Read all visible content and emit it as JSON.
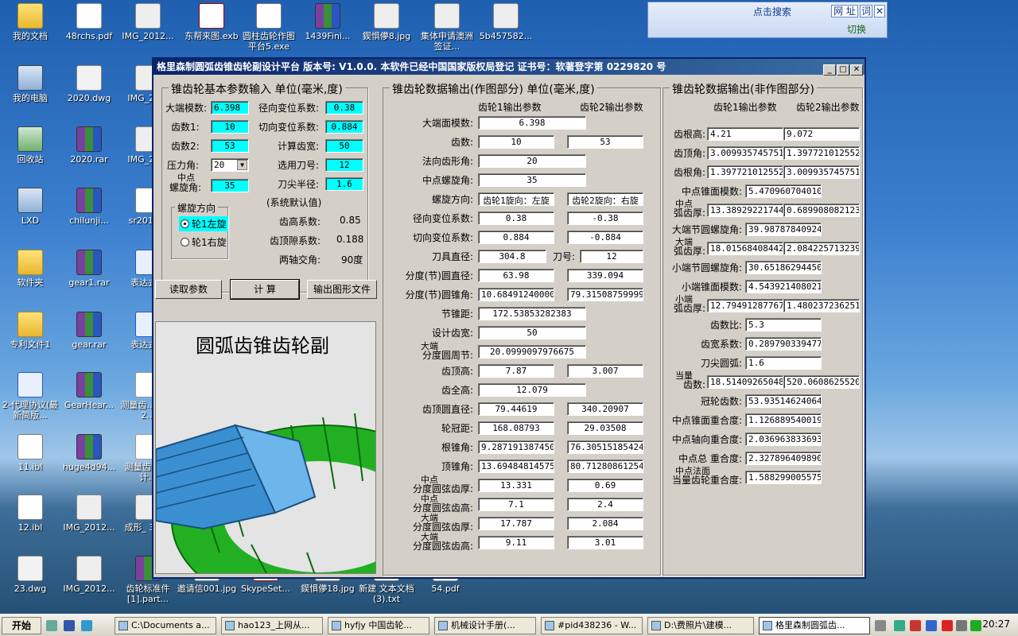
{
  "desktop": {
    "icons": [
      {
        "label": "我的文档",
        "kind": "folder"
      },
      {
        "label": "48rchs.pdf",
        "kind": "pdf"
      },
      {
        "label": "IMG_2012...",
        "kind": "jpg"
      },
      {
        "label": "东帮来图.exb",
        "kind": "exe"
      },
      {
        "label": "圆柱齿轮作图平台5.exe",
        "kind": "file"
      },
      {
        "label": "1439Fini...",
        "kind": "rar"
      },
      {
        "label": "鍥惧儚8.jpg",
        "kind": "jpg"
      },
      {
        "label": "集体申请澳洲签证...",
        "kind": "jpg"
      },
      {
        "label": "5b457582...",
        "kind": "jpg"
      },
      {
        "label": "我的电脑",
        "kind": "pc"
      },
      {
        "label": "2020.dwg",
        "kind": "dwg"
      },
      {
        "label": "IMG_20...",
        "kind": "jpg"
      },
      {
        "label": "回收站",
        "kind": "bin"
      },
      {
        "label": "2020.rar",
        "kind": "rar"
      },
      {
        "label": "IMG_20...",
        "kind": "jpg"
      },
      {
        "label": "LXD",
        "kind": "pc"
      },
      {
        "label": "chilunji...",
        "kind": "rar"
      },
      {
        "label": "sr2011...",
        "kind": "file"
      },
      {
        "label": "软件夹",
        "kind": "folder"
      },
      {
        "label": "gear1.rar",
        "kind": "rar"
      },
      {
        "label": "表达式...",
        "kind": "doc"
      },
      {
        "label": "专利文件1",
        "kind": "folder"
      },
      {
        "label": "gear.rar",
        "kind": "rar"
      },
      {
        "label": "表达式...",
        "kind": "doc"
      },
      {
        "label": "2-代理协议(最新简版...",
        "kind": "doc"
      },
      {
        "label": "GearHear...",
        "kind": "rar"
      },
      {
        "label": "测量齿... 设计2...",
        "kind": "pdf"
      },
      {
        "label": "11.ibl",
        "kind": "file"
      },
      {
        "label": "huge4d94...",
        "kind": "rar"
      },
      {
        "label": "测量齿... 设计...",
        "kind": "pdf"
      },
      {
        "label": "12.ibl",
        "kind": "file"
      },
      {
        "label": "IMG_2012...",
        "kind": "jpg"
      },
      {
        "label": "成形_ 3.0...",
        "kind": "jpg"
      },
      {
        "label": "23.dwg",
        "kind": "dwg"
      },
      {
        "label": "IMG_2012...",
        "kind": "jpg"
      },
      {
        "label": "齿轮标准件[1].part...",
        "kind": "rar"
      },
      {
        "label": "邀请信001.jpg",
        "kind": "jpg"
      },
      {
        "label": "SkypeSet...",
        "kind": "exe"
      },
      {
        "label": "鍥惧儚18.jpg",
        "kind": "jpg"
      },
      {
        "label": "新建 文本文档 (3).txt",
        "kind": "file"
      },
      {
        "label": "54.pdf",
        "kind": "pdf"
      }
    ]
  },
  "searchbar": {
    "title": "点击搜索",
    "btn_url": "网 址",
    "btn_word": "词",
    "close": "✕",
    "switch": "切换"
  },
  "window": {
    "title": "格里森制圆弧齿锥齿轮副设计平台  版本号: V1.0.0.   本软件已经中国国家版权局登记   证书号：软著登字第 0229820 号",
    "controls": [
      "_",
      "□",
      "✕"
    ]
  },
  "input_panel": {
    "title": "锥齿轮基本参数输入  单位(毫米,度)",
    "fields": {
      "module_label": "大端模数:",
      "module": "6.398",
      "z1_label": "齿数1:",
      "z1": "10",
      "z2_label": "齿数2:",
      "z2": "53",
      "pressure_label": "压力角:",
      "pressure": "20",
      "spiral_label1": "中点",
      "spiral_label2": "螺旋角:",
      "spiral": "35",
      "radial_shift_label": "径向变位系数:",
      "radial_shift": "0.38",
      "tangent_shift_label": "切向变位系数:",
      "tangent_shift": "0.884",
      "calc_width_label": "计算齿宽:",
      "calc_width": "50",
      "cutter_no_label": "选用刀号:",
      "cutter_no": "12",
      "tip_radius_label": "刀尖半径:",
      "tip_radius": "1.6"
    },
    "direction": {
      "title": "螺旋方向",
      "left": "轮1左旋",
      "right": "轮1右旋",
      "selected": "left"
    },
    "defaults": {
      "title": "(系统默认值)",
      "addendum_label": "齿高系数:",
      "addendum": "0.85",
      "clearance_label": "齿顶隙系数:",
      "clearance": "0.188",
      "shaft_label": "两轴交角:",
      "shaft": "90度"
    },
    "buttons": {
      "read": "读取参数",
      "calc": "计  算",
      "export": "输出图形文件"
    },
    "picture_title": "圆弧齿锥齿轮副"
  },
  "drawing_output": {
    "title": "锥齿轮数据输出(作图部分) 单位(毫米,度)",
    "col1": "齿轮1输出参数",
    "col2": "齿轮2输出参数",
    "rows": [
      {
        "label": "大端面模数:",
        "v1": "6.398",
        "v2": null,
        "wide": true
      },
      {
        "label": "齿数:",
        "v1": "10",
        "v2": "53"
      },
      {
        "label": "法向齿形角:",
        "v1": "20",
        "v2": null
      },
      {
        "label": "中点螺旋角:",
        "v1": "35",
        "v2": null
      },
      {
        "label": "螺旋方向:",
        "v1": "齿轮1旋向：左旋",
        "v2": "齿轮2旋向：右旋"
      },
      {
        "label": "径向变位系数:",
        "v1": "0.38",
        "v2": "-0.38"
      },
      {
        "label": "切向变位系数:",
        "v1": "0.884",
        "v2": "-0.884"
      },
      {
        "label": "刀具直径:",
        "v1": "304.8",
        "v2": "12",
        "mid_label": "刀号:"
      },
      {
        "label": "分度(节)圆直径:",
        "v1": "63.98",
        "v2": "339.094"
      },
      {
        "label": "分度(节)圆锥角:",
        "v1": "10.684912400002",
        "v2": "79.315087599997"
      },
      {
        "label": "节锥距:",
        "v1": "172.53853282383",
        "v2": null
      },
      {
        "label": "设计齿宽:",
        "v1": "50",
        "v2": null
      },
      {
        "label": "分度圆周节:",
        "label_top": "大端",
        "v1": "20.0999097976675",
        "v2": null
      },
      {
        "label": "齿顶高:",
        "v1": "7.87",
        "v2": "3.007"
      },
      {
        "label": "齿全高:",
        "v1": "12.079",
        "v2": null
      },
      {
        "label": "齿顶圆直径:",
        "v1": "79.44619",
        "v2": "340.20907"
      },
      {
        "label": "轮冠距:",
        "v1": "168.08793",
        "v2": "29.03508"
      },
      {
        "label": "根锥角:",
        "v1": "9.2871913874506",
        "v2": "76.305151854245"
      },
      {
        "label": "顶锥角:",
        "v1": "13.694848145754",
        "v2": "80.712808612549"
      },
      {
        "label": "分度圆弦齿厚:",
        "label_top": "中点",
        "v1": "13.331",
        "v2": "0.69"
      },
      {
        "label": "分度圆弦齿高:",
        "label_top": "中点",
        "v1": "7.1",
        "v2": "2.4"
      },
      {
        "label": "分度圆弦齿厚:",
        "label_top": "大端",
        "v1": "17.787",
        "v2": "2.084"
      },
      {
        "label": "分度圆弦齿高:",
        "label_top": "大端",
        "v1": "9.11",
        "v2": "3.01"
      }
    ]
  },
  "nondrawing_output": {
    "title": "锥齿轮数据输出(非作图部分)",
    "col1": "齿轮1输出参数",
    "col2": "齿轮2输出参数",
    "rows": [
      {
        "label": "齿根高:",
        "v1": "4.21",
        "v2": "9.072"
      },
      {
        "label": "齿顶角:",
        "v1": "3.0099357457514",
        "v2": "1.3977210125521"
      },
      {
        "label": "齿根角:",
        "v1": "1.3977210125521",
        "v2": "3.0099357457514"
      },
      {
        "label": "中点锥面模数:",
        "v1": "5.4709607040108",
        "v2": null
      },
      {
        "label": "弧齿厚:",
        "label_top": "中点",
        "v1": "13.389292217447",
        "v2": "0.6899080821238"
      },
      {
        "label": "大端节圆螺旋角:",
        "v1": "39.987878409243",
        "v2": null
      },
      {
        "label": "弧齿厚:",
        "label_top": "大端",
        "v1": "18.015684084428",
        "v2": "2.0842257132392"
      },
      {
        "label": "小端节圆螺旋角:",
        "v1": "30.651862944500",
        "v2": null
      },
      {
        "label": "小端锥面模数:",
        "v1": "4.5439214080217",
        "v2": null
      },
      {
        "label": "弧齿厚:",
        "label_top": "小端",
        "v1": "12.794912877679",
        "v2": "1.4802372362515"
      },
      {
        "label": "齿数比:",
        "v1": "5.3",
        "v2": null
      },
      {
        "label": "齿宽系数:",
        "v1": "0.2897903394776",
        "v2": null
      },
      {
        "label": "刀尖圆弧:",
        "v1": "1.6",
        "v2": null
      },
      {
        "label": "齿数:",
        "label_top": "当量",
        "v1": "18.514092650482",
        "v2": "520.06086255205"
      },
      {
        "label": "冠轮齿数:",
        "v1": "53.935146240647",
        "v2": null
      },
      {
        "label": "中点锥面重合度:",
        "v1": "1.1268895400192",
        "v2": null
      },
      {
        "label": "中点轴向重合度:",
        "v1": "2.0369638336934",
        "v2": null
      },
      {
        "label": "中点总  重合度:",
        "v1": "2.3278964098902",
        "v2": null
      },
      {
        "label": "当量齿轮重合度:",
        "label_top": "中点法面",
        "v1": "1.5882990055757",
        "v2": null
      }
    ]
  },
  "taskbar": {
    "start": "开始",
    "items": [
      {
        "label": "C:\\Documents a..."
      },
      {
        "label": "hao123_上网从..."
      },
      {
        "label": "hyfjy 中国齿轮..."
      },
      {
        "label": "机械设计手册(..."
      },
      {
        "label": "#pid438236 - W..."
      },
      {
        "label": "D:\\费照片\\建模..."
      },
      {
        "label": "格里森制圆弧齿..."
      }
    ],
    "clock": "20:27"
  }
}
